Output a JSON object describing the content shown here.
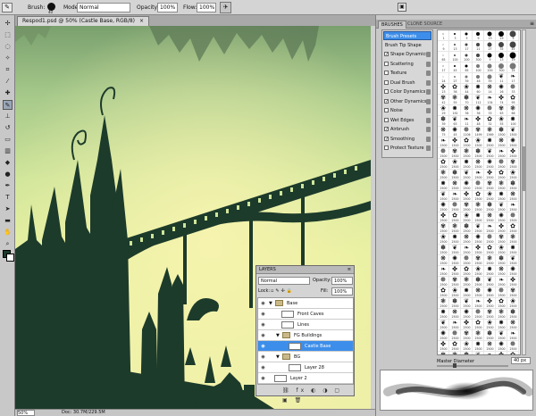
{
  "options_bar": {
    "brush_label": "Brush:",
    "brush_size": "40",
    "mode_label": "Mode:",
    "mode_value": "Normal",
    "opacity_label": "Opacity:",
    "opacity_value": "100%",
    "flow_label": "Flow:",
    "flow_value": "100%"
  },
  "document": {
    "tab_title": "Respod1.psd @ 50% (Castle Base, RGB/8)",
    "close": "×",
    "zoom": "50%",
    "doc_info": "Doc: 30.7M/229.5M"
  },
  "layers_panel": {
    "title": "LAYERS",
    "blend_mode": "Normal",
    "opacity_label": "Opacity:",
    "opacity_value": "100%",
    "lock_label": "Lock:",
    "fill_label": "Fill:",
    "fill_value": "100%",
    "layers": [
      {
        "name": "Base",
        "kind": "group",
        "indent": 0
      },
      {
        "name": "Front Caves",
        "kind": "layer",
        "indent": 1
      },
      {
        "name": "Lines",
        "kind": "layer",
        "indent": 1
      },
      {
        "name": "FG Buildings",
        "kind": "group",
        "indent": 1
      },
      {
        "name": "Castle Base",
        "kind": "layer",
        "indent": 2,
        "selected": true
      },
      {
        "name": "BG",
        "kind": "group",
        "indent": 1
      },
      {
        "name": "Layer 28",
        "kind": "layer",
        "indent": 2
      },
      {
        "name": "Layer 2",
        "kind": "layer",
        "indent": 0
      }
    ]
  },
  "brushes_panel": {
    "tab_brushes": "BRUSHES",
    "tab_clone": "CLONE SOURCE",
    "preset_label": "Brush Presets",
    "tip_shape": "Brush Tip Shape",
    "options": [
      {
        "label": "Shape Dynamics",
        "checked": true
      },
      {
        "label": "Scattering",
        "checked": false
      },
      {
        "label": "Texture",
        "checked": false
      },
      {
        "label": "Dual Brush",
        "checked": false
      },
      {
        "label": "Color Dynamics",
        "checked": false
      },
      {
        "label": "Other Dynamics",
        "checked": true
      },
      {
        "label": "Noise",
        "checked": false
      },
      {
        "label": "Wet Edges",
        "checked": false
      },
      {
        "label": "Airbrush",
        "checked": true
      },
      {
        "label": "Smoothing",
        "checked": true
      },
      {
        "label": "Protect Texture",
        "checked": false
      }
    ],
    "master_label": "Master Diameter",
    "master_value": "40 px",
    "brush_sizes": [
      "1",
      "3",
      "5",
      "9",
      "13",
      "19",
      "5",
      "9",
      "13",
      "17",
      "21",
      "27",
      "35",
      "45",
      "65",
      "100",
      "200",
      "300",
      "9",
      "13",
      "19",
      "17",
      "45",
      "65",
      "100",
      "200",
      "300",
      "14",
      "24",
      "27",
      "39",
      "46",
      "59",
      "11",
      "17",
      "23",
      "36",
      "44",
      "60",
      "14",
      "26",
      "33",
      "42",
      "55",
      "70",
      "112",
      "134",
      "74",
      "95",
      "29",
      "192",
      "36",
      "36",
      "33",
      "63",
      "66",
      "39",
      "63",
      "11",
      "48",
      "32",
      "55",
      "100",
      "75",
      "45",
      "1106",
      "1499",
      "1569",
      "1500",
      "1500",
      "1500",
      "1500",
      "1500",
      "1500",
      "2500",
      "2500",
      "2500",
      "2500",
      "2500",
      "2500",
      "2500",
      "2500",
      "2500",
      "2500",
      "2500",
      "2500",
      "2500",
      "2500",
      "2500",
      "2500",
      "2500",
      "2500",
      "2500",
      "2500",
      "2500",
      "2500",
      "2500",
      "2500",
      "2500",
      "2500",
      "2500",
      "2500",
      "2500",
      "2500",
      "2500",
      "2500",
      "2500",
      "2500",
      "2500",
      "2500",
      "2500",
      "2500",
      "2500",
      "2500",
      "2500",
      "2500",
      "2500",
      "2500",
      "2500",
      "2500",
      "2500",
      "2500",
      "2500",
      "2500",
      "2500",
      "2500",
      "2500",
      "2500",
      "2500",
      "2500",
      "2500",
      "2500",
      "2500",
      "2500",
      "2500",
      "2500",
      "2500",
      "2500",
      "2500",
      "2500",
      "2500",
      "2500",
      "2500",
      "2500",
      "2500",
      "2500",
      "2500",
      "2500",
      "2500",
      "2500",
      "2500",
      "2500",
      "2500",
      "2500",
      "2500",
      "2500",
      "2500",
      "2500",
      "2500",
      "2500",
      "2500",
      "2500",
      "2500",
      "2500",
      "2500",
      "2500",
      "2500",
      "2500",
      "2500",
      "2500",
      "2500",
      "2500",
      "2500",
      "2500",
      "2500",
      "2500",
      "2500",
      "2500",
      "2500",
      "2500",
      "2500",
      "2500",
      "2500",
      "2500",
      "2500",
      "2500",
      "2500",
      "2500",
      "2500",
      "2500",
      "2500",
      "2500",
      "2500",
      "2500",
      "2500",
      "2500",
      "2500",
      "2500",
      "2500",
      "2500",
      "2500",
      "2500",
      "2500",
      "2500",
      "2500",
      "2500",
      "2500",
      "2500",
      "2500",
      "2500",
      "2500",
      "2500",
      "2500",
      "2500",
      "2500",
      "2500",
      "2500"
    ]
  },
  "colors": {
    "foreground": "#1d3b2b",
    "background": "#ffffff",
    "selection": "#3d8eea",
    "silhouette": "#1d3b2b"
  }
}
